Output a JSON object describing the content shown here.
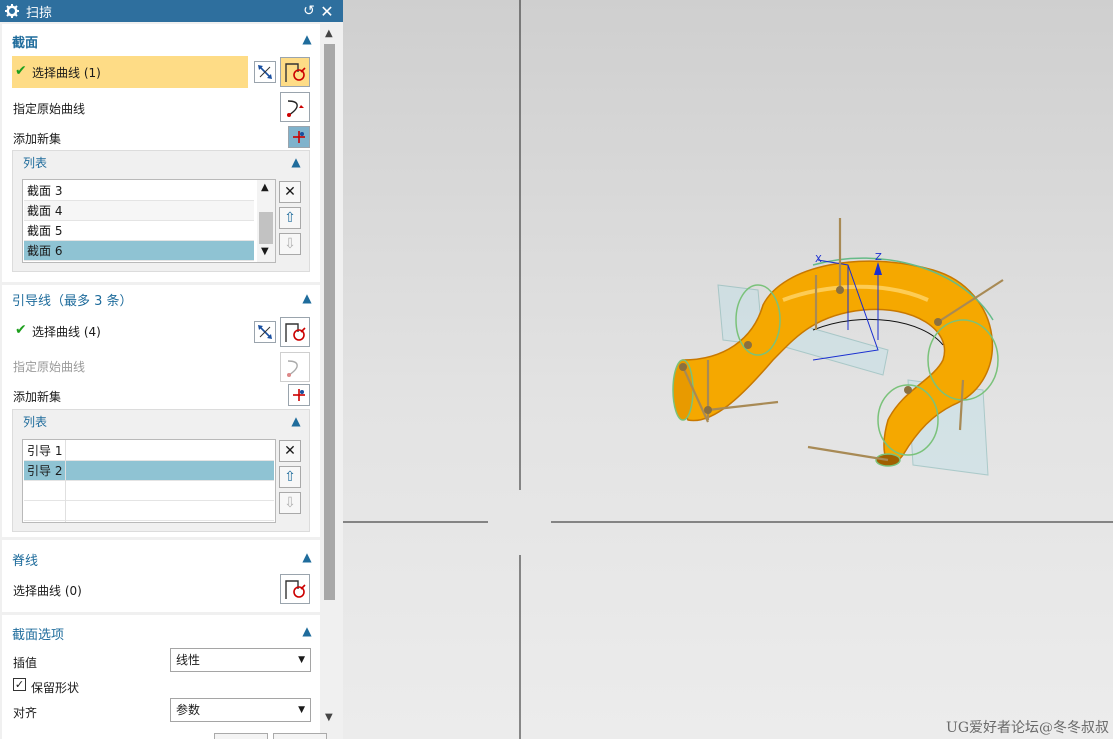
{
  "dialog": {
    "title": "扫掠",
    "section": {
      "title": "截面",
      "select_curve": "选择曲线 (1)",
      "specify_origin": "指定原始曲线",
      "add_new_set": "添加新集",
      "list_title": "列表",
      "list_items": [
        "截面 3",
        "截面 4",
        "截面 5",
        "截面 6"
      ],
      "selected_index": 3
    },
    "guides": {
      "title": "引导线（最多 3 条）",
      "select_curve": "选择曲线 (4)",
      "specify_origin": "指定原始曲线",
      "add_new_set": "添加新集",
      "list_title": "列表",
      "list_items": [
        "引导 1",
        "引导 2"
      ],
      "selected_index": 1
    },
    "spine": {
      "title": "脊线",
      "select_curve": "选择曲线 (0)"
    },
    "section_options": {
      "title": "截面选项",
      "interpolation_label": "插值",
      "interpolation_value": "线性",
      "preserve_shape_label": "保留形状",
      "preserve_shape_checked": true,
      "alignment_label": "对齐",
      "alignment_value": "参数"
    }
  },
  "viewport": {
    "axis_labels": {
      "x": "X",
      "z": "Z"
    },
    "watermark": "UG爱好者论坛@冬冬叔叔",
    "body_color": "#f5a800"
  }
}
